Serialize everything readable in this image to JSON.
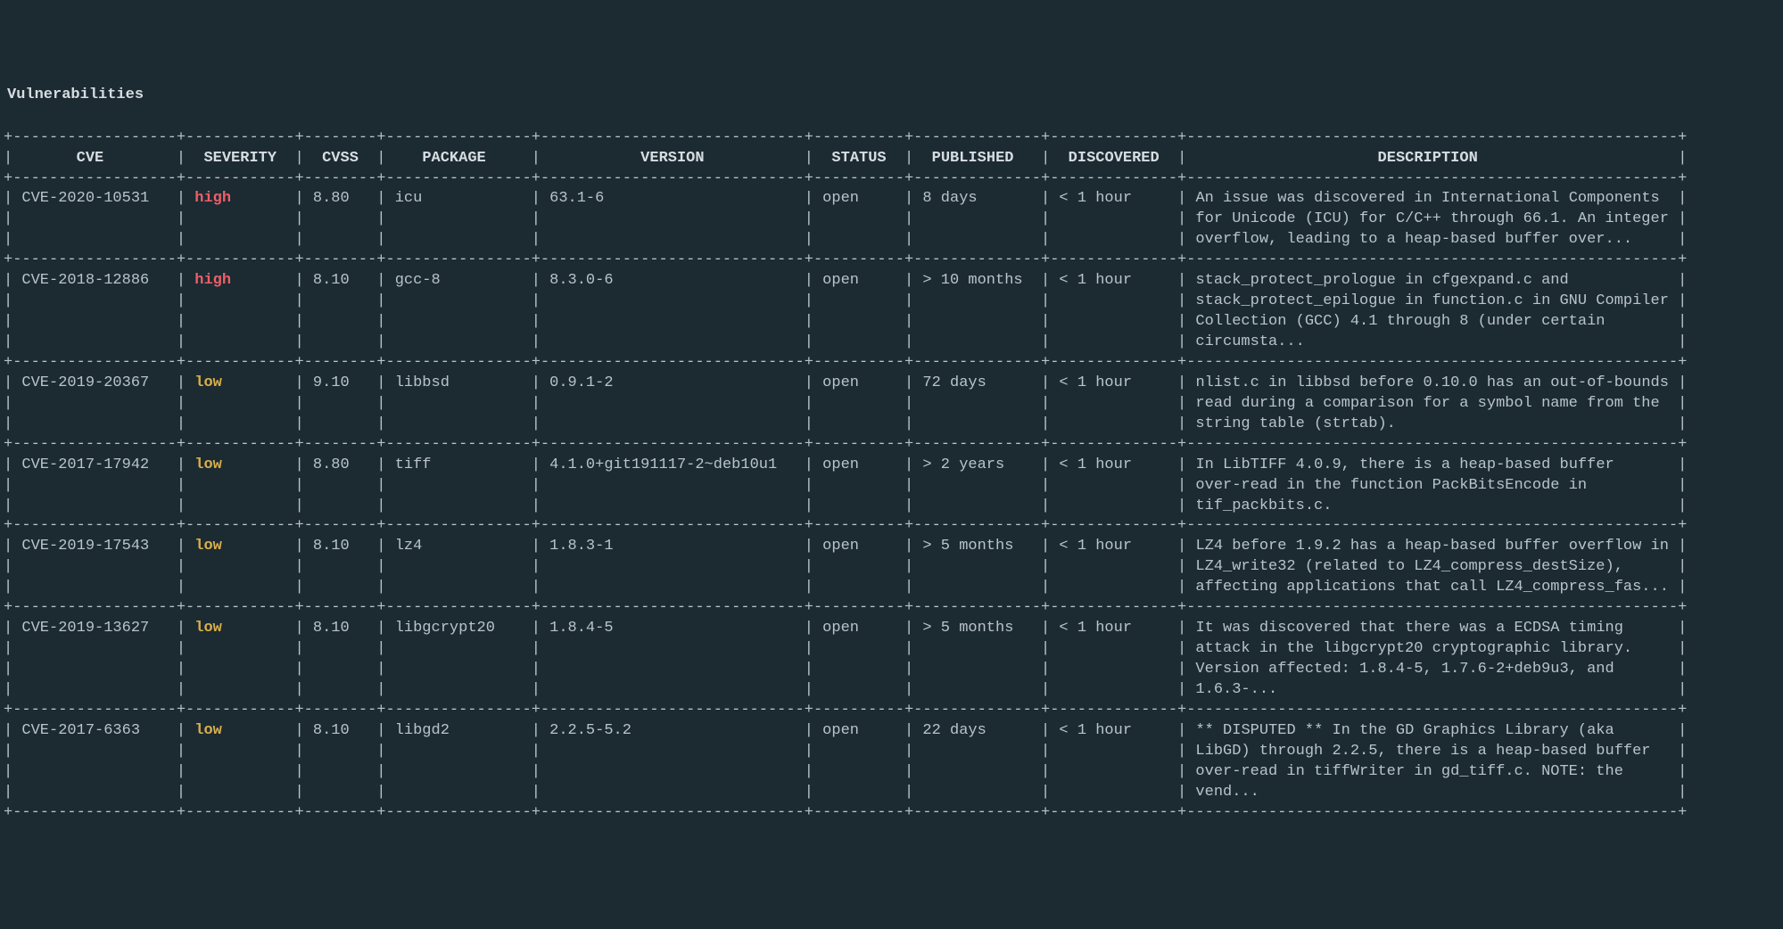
{
  "title": "Vulnerabilities",
  "columns": [
    {
      "key": "cve",
      "label": "CVE",
      "width": 16
    },
    {
      "key": "severity",
      "label": "SEVERITY",
      "width": 10
    },
    {
      "key": "cvss",
      "label": "CVSS",
      "width": 6
    },
    {
      "key": "package",
      "label": "PACKAGE",
      "width": 14
    },
    {
      "key": "version",
      "label": "VERSION",
      "width": 27
    },
    {
      "key": "status",
      "label": "STATUS",
      "width": 8
    },
    {
      "key": "published",
      "label": "PUBLISHED",
      "width": 12
    },
    {
      "key": "discovered",
      "label": "DISCOVERED",
      "width": 12
    },
    {
      "key": "description",
      "label": "DESCRIPTION",
      "width": 52
    }
  ],
  "severity_colors": {
    "critical": "#ff3b30",
    "high": "#ec5f67",
    "medium": "#f6c177",
    "low": "#d8b04a"
  },
  "rows": [
    {
      "cve": "CVE-2020-10531",
      "severity": "high",
      "cvss": "8.80",
      "package": "icu",
      "version": "63.1-6",
      "status": "open",
      "published": "8 days",
      "discovered": "< 1 hour",
      "description": "An issue was discovered in International Components for Unicode (ICU) for C/C++ through 66.1. An integer overflow, leading to a heap-based buffer over..."
    },
    {
      "cve": "CVE-2018-12886",
      "severity": "high",
      "cvss": "8.10",
      "package": "gcc-8",
      "version": "8.3.0-6",
      "status": "open",
      "published": "> 10 months",
      "discovered": "< 1 hour",
      "description": "stack_protect_prologue in cfgexpand.c and stack_protect_epilogue in function.c in GNU Compiler Collection (GCC) 4.1 through 8 (under certain circumsta..."
    },
    {
      "cve": "CVE-2019-20367",
      "severity": "low",
      "cvss": "9.10",
      "package": "libbsd",
      "version": "0.9.1-2",
      "status": "open",
      "published": "72 days",
      "discovered": "< 1 hour",
      "description": "nlist.c in libbsd before 0.10.0 has an out-of-bounds read during a comparison for a symbol name from the string table (strtab)."
    },
    {
      "cve": "CVE-2017-17942",
      "severity": "low",
      "cvss": "8.80",
      "package": "tiff",
      "version": "4.1.0+git191117-2~deb10u1",
      "status": "open",
      "published": "> 2 years",
      "discovered": "< 1 hour",
      "description": "In LibTIFF 4.0.9, there is a heap-based buffer over-read in the function PackBitsEncode in tif_packbits.c."
    },
    {
      "cve": "CVE-2019-17543",
      "severity": "low",
      "cvss": "8.10",
      "package": "lz4",
      "version": "1.8.3-1",
      "status": "open",
      "published": "> 5 months",
      "discovered": "< 1 hour",
      "description": "LZ4 before 1.9.2 has a heap-based buffer overflow in LZ4_write32 (related to LZ4_compress_destSize), affecting applications that call LZ4_compress_fas..."
    },
    {
      "cve": "CVE-2019-13627",
      "severity": "low",
      "cvss": "8.10",
      "package": "libgcrypt20",
      "version": "1.8.4-5",
      "status": "open",
      "published": "> 5 months",
      "discovered": "< 1 hour",
      "description": "It was discovered that there was a ECDSA timing attack in the libgcrypt20 cryptographic library. Version affected: 1.8.4-5, 1.7.6-2+deb9u3, and 1.6.3-..."
    },
    {
      "cve": "CVE-2017-6363",
      "severity": "low",
      "cvss": "8.10",
      "package": "libgd2",
      "version": "2.2.5-5.2",
      "status": "open",
      "published": "22 days",
      "discovered": "< 1 hour",
      "description": "** DISPUTED ** In the GD Graphics Library (aka LibGD) through 2.2.5, there is a heap-based buffer over-read in tiffWriter in gd_tiff.c. NOTE: the vend..."
    }
  ]
}
